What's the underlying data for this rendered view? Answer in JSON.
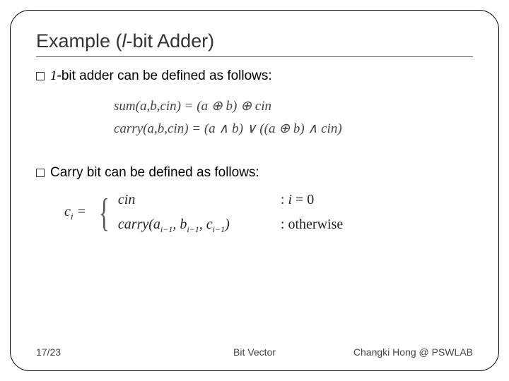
{
  "title_prefix": "Example (",
  "title_italic": "l",
  "title_suffix": "-bit Adder)",
  "bullets": {
    "b1_num": "1",
    "b1_rest": "-bit adder can be defined as follows:",
    "b2": "Carry bit can be defined as follows:"
  },
  "eqs": {
    "sum": "sum(a,b,cin) = (a ⊕ b) ⊕ cin",
    "carry": "carry(a,b,cin) = (a ∧ b) ∨ ((a ⊕ b) ∧ cin)"
  },
  "cases": {
    "lhs_var": "c",
    "lhs_sub": "i",
    "eq": " = ",
    "row1_expr": "cin",
    "row1_cond_prefix": ": ",
    "row1_cond_var": "i",
    "row1_cond_rest": " = 0",
    "row2_fn": "carry",
    "row2_open": "(",
    "row2_a": "a",
    "row2_b": "b",
    "row2_c": "c",
    "row2_sub": "i−1",
    "row2_close": ")",
    "row2_cond": ": otherwise"
  },
  "footer": {
    "page": "17/23",
    "center": "Bit   Vector",
    "author": "Changki Hong @ PSWLAB"
  }
}
